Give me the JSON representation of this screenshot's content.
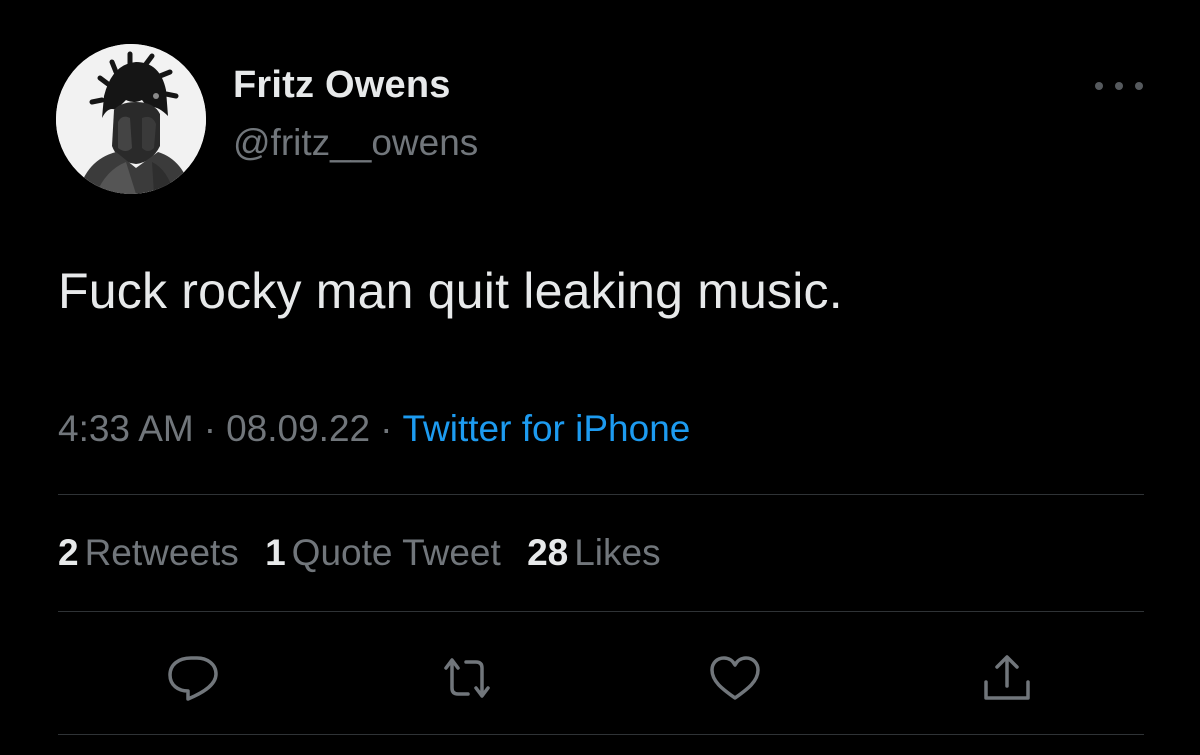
{
  "author": {
    "display_name": "Fritz Owens",
    "handle": "@fritz__owens"
  },
  "tweet": {
    "text": "Fuck rocky man quit leaking music.",
    "time": "4:33 AM",
    "date": "08.09.22",
    "separator": "·",
    "source": "Twitter for iPhone"
  },
  "stats": {
    "retweets_count": "2",
    "retweets_label": "Retweets",
    "quotes_count": "1",
    "quotes_label": "Quote Tweet",
    "likes_count": "28",
    "likes_label": "Likes"
  },
  "actions": [
    {
      "name": "reply",
      "icon": "reply-icon"
    },
    {
      "name": "retweet",
      "icon": "retweet-icon"
    },
    {
      "name": "like",
      "icon": "heart-icon"
    },
    {
      "name": "share",
      "icon": "share-icon"
    }
  ],
  "colors": {
    "background": "#000000",
    "text_primary": "#e7e9ea",
    "text_secondary": "#71767b",
    "accent": "#1d9bf0",
    "divider": "#2f3336"
  }
}
